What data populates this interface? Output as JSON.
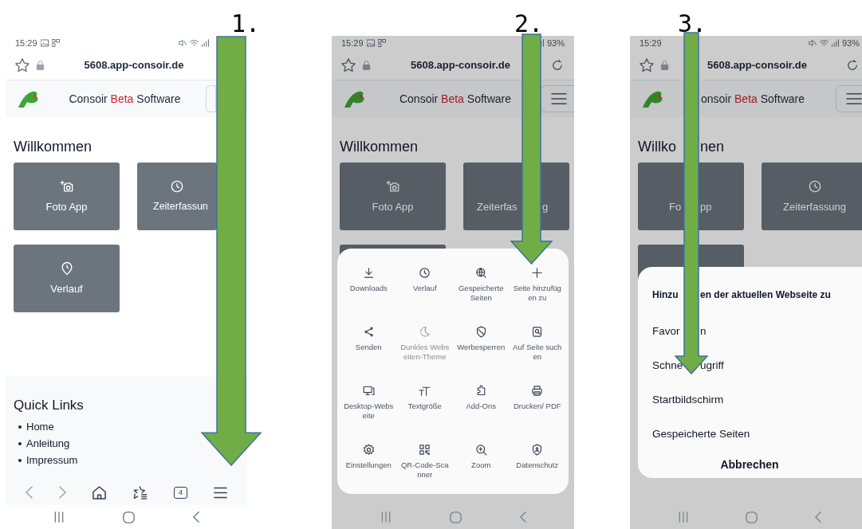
{
  "panels": [
    {
      "step": "1.",
      "dimmed": false,
      "time": "15:29",
      "url": "5608.app-consoir.de",
      "reload": false,
      "brand": [
        {
          "text": "Consoir",
          "accent": false
        },
        {
          "text": "Beta",
          "accent": true
        },
        {
          "text": "Software",
          "accent": false
        }
      ],
      "heading": "Willkommen",
      "tiles": [
        {
          "kind": "tile",
          "label": "Foto App"
        },
        {
          "kind": "tile",
          "label": "Zeiterfassun"
        },
        {
          "kind": "tile",
          "label": "Verlauf"
        }
      ],
      "quick_links": {
        "title": "Quick Links",
        "items": [
          "Home",
          "Anleitung",
          "Impressum"
        ]
      },
      "bottom_bar": {
        "tab_count": "4"
      }
    },
    {
      "step": "2.",
      "dimmed": true,
      "time": "15:29",
      "battery": "93%",
      "url": "5608.app-consoir.de",
      "reload": true,
      "brand": [
        {
          "text": "Consoir",
          "accent": false
        },
        {
          "text": "Beta",
          "accent": true
        },
        {
          "text": "Software",
          "accent": false
        }
      ],
      "heading": "Willkommen",
      "tiles": [
        {
          "kind": "tile",
          "label": "Foto App"
        },
        {
          "kind": "tile",
          "label": [
            "Zeiterfas",
            "g"
          ]
        },
        {
          "kind": "tile"
        }
      ],
      "menu": {
        "items": [
          {
            "label": "Downloads",
            "disabled": false
          },
          {
            "label": "Verlauf",
            "disabled": false
          },
          {
            "label": "Gespeicherte Seiten",
            "disabled": false
          },
          {
            "label": "Seite hinzufügen zu",
            "disabled": false
          },
          {
            "label": "Senden",
            "disabled": false
          },
          {
            "label": "Dunkles Webseiten-Theme",
            "disabled": true
          },
          {
            "label": "Werbesperren",
            "disabled": false
          },
          {
            "label": "Auf Seite suchen",
            "disabled": false
          },
          {
            "label": "Desktop-Webseite",
            "disabled": false
          },
          {
            "label": "Textgröße",
            "disabled": false
          },
          {
            "label": "Add-Ons",
            "disabled": false
          },
          {
            "label": "Drucken/ PDF",
            "disabled": false
          },
          {
            "label": "Einstellungen",
            "disabled": false
          },
          {
            "label": "QR-Code-Scanner",
            "disabled": false
          },
          {
            "label": "Zoom",
            "disabled": false
          },
          {
            "label": "Datenschutz",
            "disabled": false
          }
        ]
      }
    },
    {
      "step": "3.",
      "dimmed": true,
      "time": "15:29",
      "battery": "93%",
      "url": "5608.app-consoir.de",
      "reload": true,
      "brand": [
        {
          "text": "onsoir",
          "accent": false
        },
        {
          "text": "Beta",
          "accent": true
        },
        {
          "text": "Software",
          "accent": false
        }
      ],
      "heading": [
        "Willko",
        "nen"
      ],
      "tiles": [
        {
          "kind": "tile",
          "label": [
            "Fo",
            "pp"
          ]
        },
        {
          "kind": "tile",
          "label": "Zeiterfassung"
        },
        {
          "kind": "tile"
        }
      ],
      "dialog": {
        "title": [
          "Hinzu",
          "en der aktuellen Webseite zu"
        ],
        "options": [
          [
            "Favor",
            "n"
          ],
          [
            "Schne",
            "ugriff"
          ],
          "Startbildschirm",
          "Gespeicherte Seiten"
        ],
        "cancel": "Abbrechen"
      }
    }
  ]
}
